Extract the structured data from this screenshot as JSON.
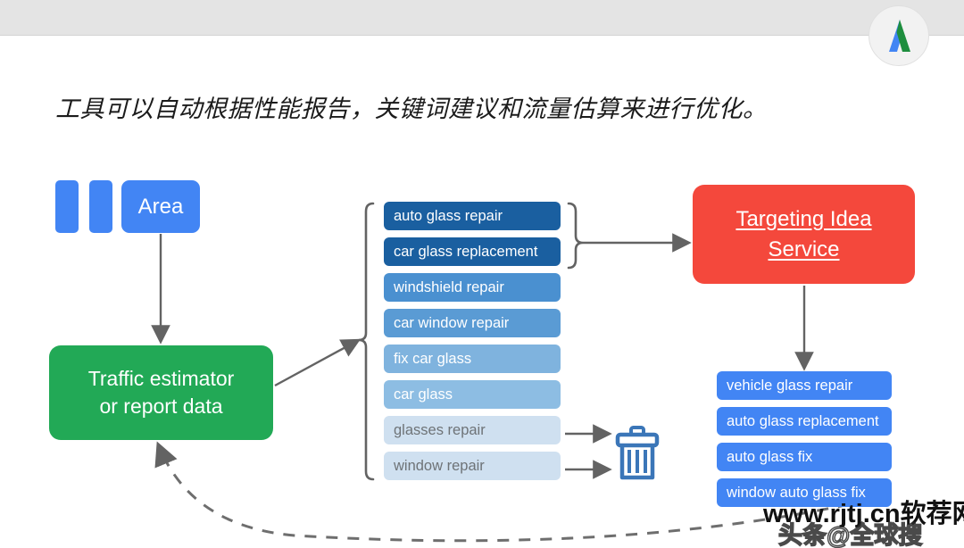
{
  "header": {
    "logo_name": "google-ads-logo",
    "logo_colors": {
      "blue": "#4285f4",
      "green": "#1e8e3e"
    },
    "bar_color": "#e4e4e4"
  },
  "slide": {
    "title": "工具可以自动根据性能报告，关键词建议和流量估算来进行优化。"
  },
  "diagram": {
    "input_blocks": {
      "bar_one_label": "",
      "bar_two_label": "",
      "area_label": "Area",
      "area_color": "#4285f4"
    },
    "source_node": {
      "label": "Traffic estimator or report data",
      "line1": "Traffic estimator",
      "line2": "or report data",
      "color": "#22a956"
    },
    "keyword_list": [
      {
        "label": "auto glass repair",
        "color": "#1a5fa0",
        "text_color": "#ffffff"
      },
      {
        "label": "car glass replacement",
        "color": "#1a5fa0",
        "text_color": "#ffffff"
      },
      {
        "label": "windshield repair",
        "color": "#4a90d0",
        "text_color": "#ffffff"
      },
      {
        "label": "car window repair",
        "color": "#5a9bd4",
        "text_color": "#ffffff"
      },
      {
        "label": "fix car glass",
        "color": "#7fb3de",
        "text_color": "#ffffff"
      },
      {
        "label": "car glass",
        "color": "#8dbde3",
        "text_color": "#ffffff"
      },
      {
        "label": "glasses repair",
        "color": "#cfe0f0",
        "text_color": "#6e7377"
      },
      {
        "label": "window repair",
        "color": "#cfe0f0",
        "text_color": "#6e7377"
      }
    ],
    "service_node": {
      "line1": "Targeting Idea",
      "line2": "Service",
      "color": "#f4483c"
    },
    "output_list": [
      {
        "label": "vehicle glass repair"
      },
      {
        "label": "auto glass replacement"
      },
      {
        "label": "auto glass fix"
      },
      {
        "label": "window auto glass fix"
      }
    ],
    "discard_icon": "trash-icon",
    "discard_icon_color": "#3b76b8"
  },
  "watermarks": {
    "primary": "www.rjtj.cn软荐网",
    "secondary": "头条@全球搜"
  }
}
